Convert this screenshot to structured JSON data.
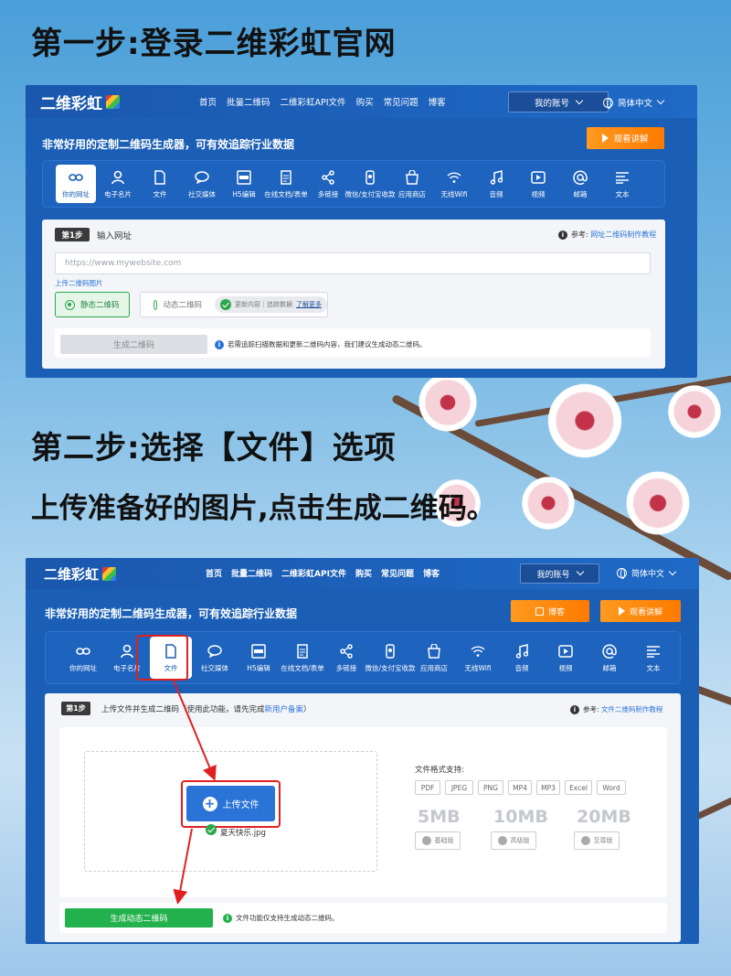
{
  "step1_heading": "第一步:登录二维彩虹官网",
  "step2_heading": "第二步:选择【文件】选项",
  "step2_sub": "上传准备好的图片,点击生成二维码。",
  "site": {
    "logo": "二维彩虹",
    "nav": [
      "首页",
      "批量二维码",
      "二维彩虹API文件",
      "购买",
      "常见问题",
      "博客"
    ],
    "account": "我的账号",
    "language": "简体中文",
    "slogan": "非常好用的定制二维码生成器，可有效追踪行业数据",
    "watch_btn": "观看讲解",
    "blog_btn": "博客",
    "tools": [
      {
        "label": "你的网址",
        "icon": "link-icon"
      },
      {
        "label": "电子名片",
        "icon": "user-icon"
      },
      {
        "label": "文件",
        "icon": "file-icon"
      },
      {
        "label": "社交媒体",
        "icon": "chat-icon"
      },
      {
        "label": "H5编辑",
        "icon": "html-icon"
      },
      {
        "label": "在线文档/表单",
        "icon": "doc-icon"
      },
      {
        "label": "多链接",
        "icon": "share-icon"
      },
      {
        "label": "微信/支付宝收款",
        "icon": "pay-icon"
      },
      {
        "label": "应用商店",
        "icon": "bag-icon"
      },
      {
        "label": "无线Wifi",
        "icon": "wifi-icon"
      },
      {
        "label": "音频",
        "icon": "music-icon"
      },
      {
        "label": "视频",
        "icon": "video-icon"
      },
      {
        "label": "邮箱",
        "icon": "at-icon"
      },
      {
        "label": "文本",
        "icon": "text-icon"
      }
    ]
  },
  "panel1": {
    "step_badge": "第1步",
    "step_title": "输入网址",
    "ref_label": "参考:",
    "ref_link": "网址二维码制作教程",
    "url_placeholder": "https://www.mywebsite.com",
    "upload_image_link": "上传二维码图片",
    "static_label": "静态二维码",
    "dynamic_label": "动态二维码",
    "dynamic_note": "更新内容｜追踪数据",
    "learn_more": "了解更多",
    "generate_btn": "生成二维码",
    "generate_note": "若需追踪扫描数据和更新二维码内容，我们建议生成动态二维码。"
  },
  "panel2": {
    "step_badge": "第1步",
    "step_title": "上传文件并生成二维码（使用此功能，请先完成",
    "step_title_link": "新用户备案",
    "step_title_end": "）",
    "ref_label": "参考:",
    "ref_link": "文件二维码制作教程",
    "upload_btn": "上传文件",
    "uploaded_file": "夏天快乐.jpg",
    "formats_title": "文件格式支持:",
    "formats": [
      "PDF",
      "JPEG",
      "PNG",
      "MP4",
      "MP3",
      "Excel",
      "Word"
    ],
    "sizes": [
      {
        "size": "5MB",
        "tier": "基础版"
      },
      {
        "size": "10MB",
        "tier": "高级版"
      },
      {
        "size": "20MB",
        "tier": "至尊版"
      }
    ],
    "generate_btn": "生成动态二维码",
    "generate_note": "文件功能仅支持生成动态二维码。"
  },
  "colors": {
    "brand_blue": "#1a5fb5",
    "orange": "#ff8a10",
    "green": "#22b14c",
    "annotation_red": "#e02020"
  }
}
